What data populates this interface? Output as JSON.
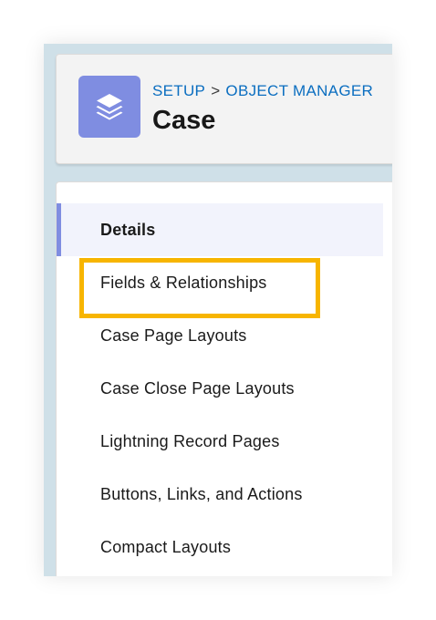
{
  "header": {
    "icon": "layers-icon",
    "icon_color": "#7f8de1",
    "breadcrumb": [
      {
        "label": "SETUP"
      },
      {
        "label": "OBJECT MANAGER"
      }
    ],
    "breadcrumb_separator": ">",
    "title": "Case"
  },
  "nav": {
    "items": [
      {
        "label": "Details",
        "active": true
      },
      {
        "label": "Fields & Relationships",
        "highlighted": true
      },
      {
        "label": "Case Page Layouts"
      },
      {
        "label": "Case Close Page Layouts"
      },
      {
        "label": "Lightning Record Pages"
      },
      {
        "label": "Buttons, Links, and Actions"
      },
      {
        "label": "Compact Layouts"
      }
    ]
  },
  "colors": {
    "accent": "#7f8de1",
    "link": "#0b6ec0",
    "highlight": "#f7b500"
  }
}
